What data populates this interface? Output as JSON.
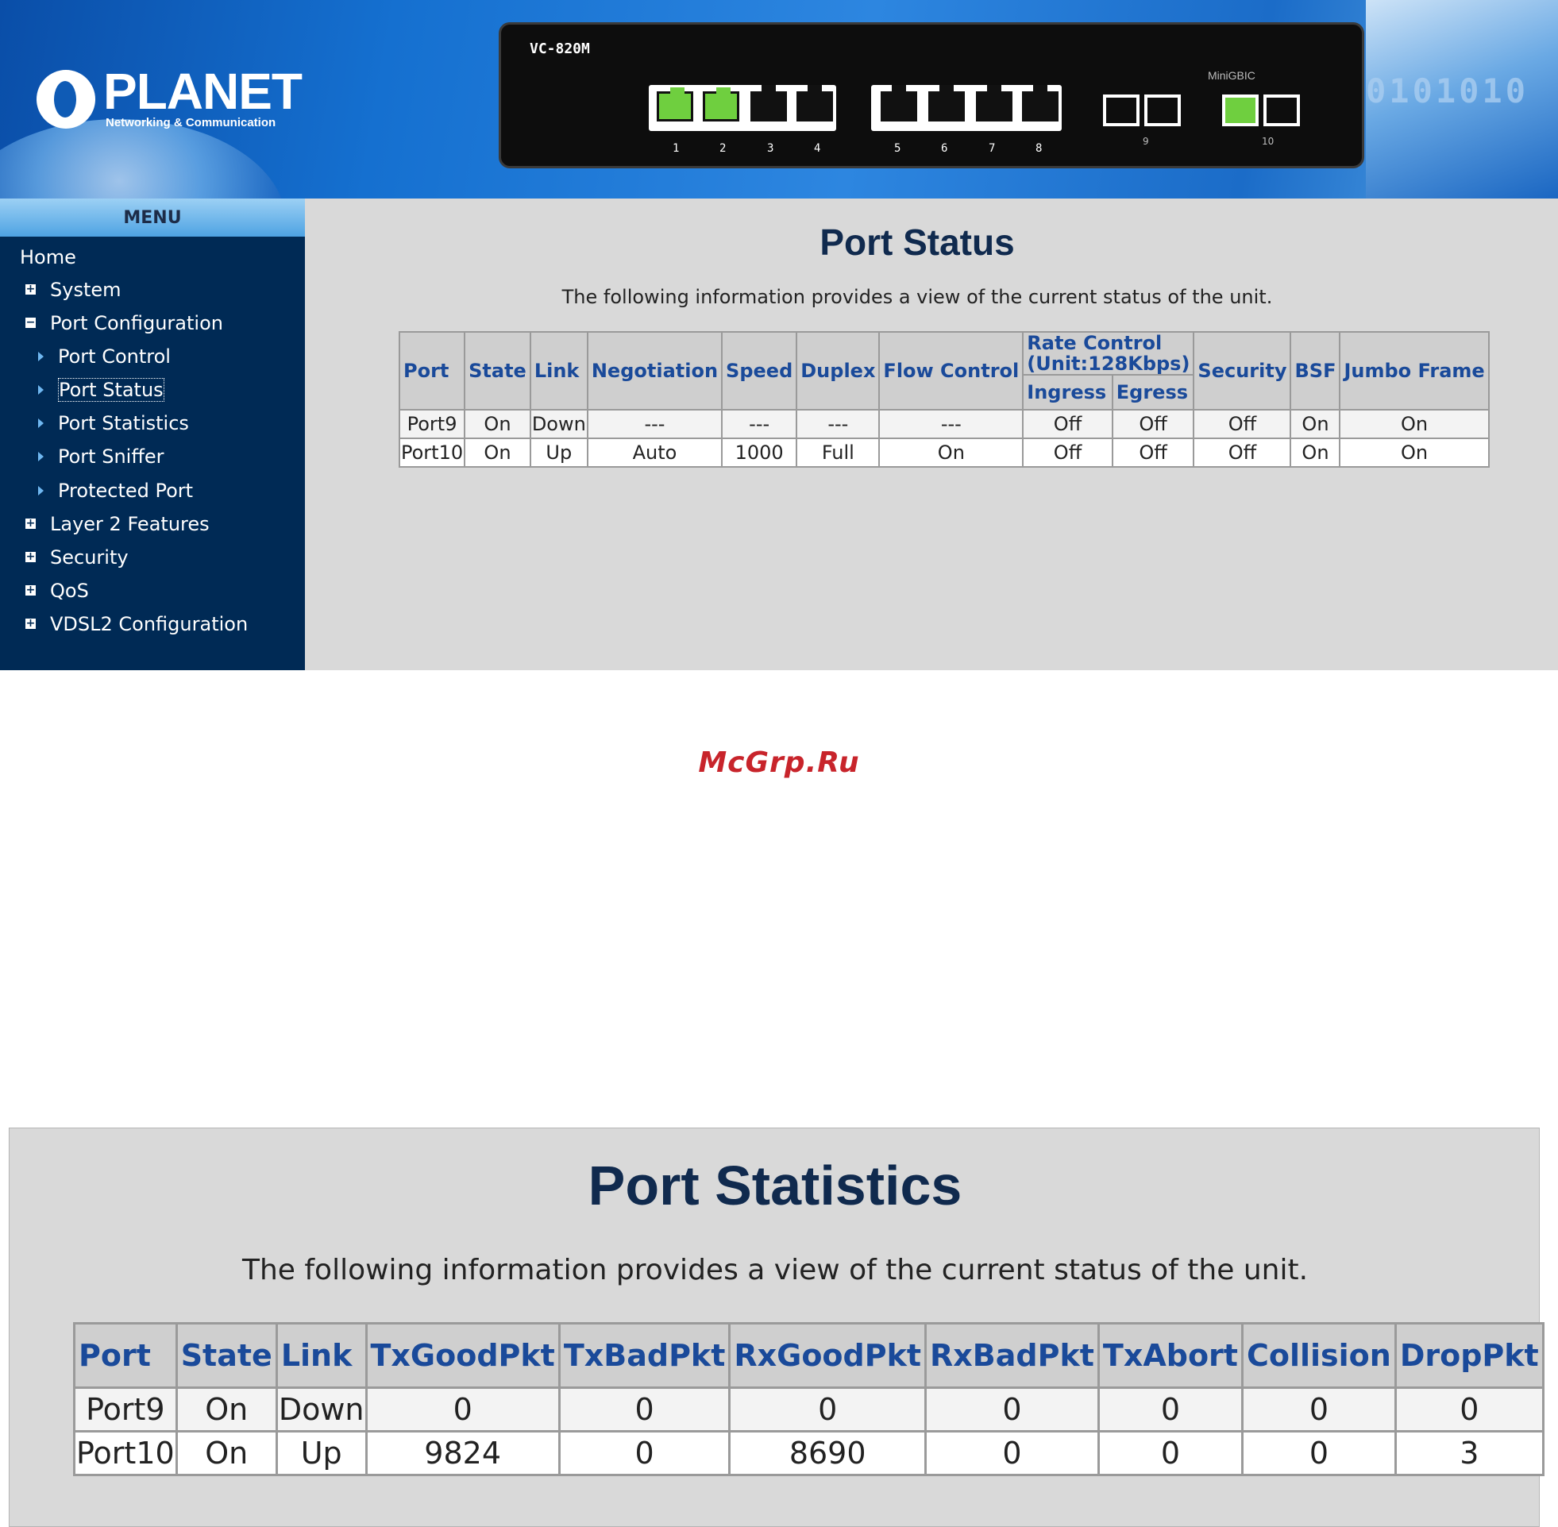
{
  "header": {
    "logo_text": "PLANET",
    "logo_subtitle": "Networking & Communication",
    "model": "VC-820M",
    "minigbic_label": "MiniGBIC",
    "port_labels": [
      "1",
      "2",
      "3",
      "4",
      "5",
      "6",
      "7",
      "8"
    ],
    "sfp_labels": [
      "9",
      "10"
    ],
    "binary_deco": "0101010"
  },
  "sidebar": {
    "title": "MENU",
    "items": [
      {
        "label": "Home",
        "icon": "none"
      },
      {
        "label": "System",
        "icon": "plus-box-icon"
      },
      {
        "label": "Port Configuration",
        "icon": "minus-box-icon"
      },
      {
        "label": "Port Control",
        "icon": "arrow-right-icon"
      },
      {
        "label": "Port Status",
        "icon": "arrow-right-icon",
        "selected": true
      },
      {
        "label": "Port Statistics",
        "icon": "arrow-right-icon"
      },
      {
        "label": "Port Sniffer",
        "icon": "arrow-right-icon"
      },
      {
        "label": "Protected Port",
        "icon": "arrow-right-icon"
      },
      {
        "label": "Layer 2 Features",
        "icon": "plus-box-icon"
      },
      {
        "label": "Security",
        "icon": "plus-box-icon"
      },
      {
        "label": "QoS",
        "icon": "plus-box-icon"
      },
      {
        "label": "VDSL2 Configuration",
        "icon": "plus-box-icon"
      }
    ]
  },
  "port_status": {
    "title": "Port Status",
    "description": "The following information provides a view of the current status of the unit.",
    "headers": {
      "port": "Port",
      "state": "State",
      "link": "Link",
      "negotiation": "Negotiation",
      "speed": "Speed",
      "duplex": "Duplex",
      "flow_control": "Flow Control",
      "rate_control": "Rate Control (Unit:128Kbps)",
      "ingress": "Ingress",
      "egress": "Egress",
      "security": "Security",
      "bsf": "BSF",
      "jumbo_frame": "Jumbo Frame"
    },
    "rows": [
      [
        "Port9",
        "On",
        "Down",
        "---",
        "---",
        "---",
        "---",
        "Off",
        "Off",
        "Off",
        "On",
        "On"
      ],
      [
        "Port10",
        "On",
        "Up",
        "Auto",
        "1000",
        "Full",
        "On",
        "Off",
        "Off",
        "Off",
        "On",
        "On"
      ]
    ]
  },
  "watermark": "McGrp.Ru",
  "port_statistics": {
    "title": "Port Statistics",
    "description": "The following information provides a view of the current status of the unit.",
    "headers": [
      "Port",
      "State",
      "Link",
      "TxGoodPkt",
      "TxBadPkt",
      "RxGoodPkt",
      "RxBadPkt",
      "TxAbort",
      "Collision",
      "DropPkt"
    ],
    "rows": [
      [
        "Port9",
        "On",
        "Down",
        "0",
        "0",
        "0",
        "0",
        "0",
        "0",
        "0"
      ],
      [
        "Port10",
        "On",
        "Up",
        "9824",
        "0",
        "8690",
        "0",
        "0",
        "0",
        "3"
      ]
    ]
  },
  "colors": {
    "sidebar_bg": "#002a55",
    "header_accent": "#1570d0",
    "table_header_text": "#1a4a9a",
    "link_led": "#6fcf3f",
    "watermark": "#c8242b"
  }
}
